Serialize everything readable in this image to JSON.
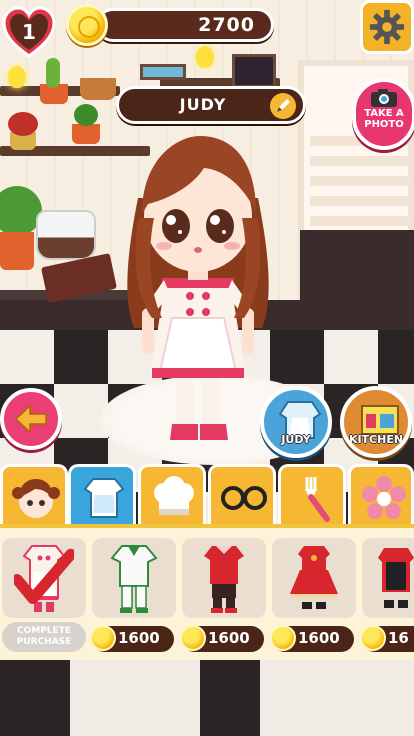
{
  "hud": {
    "level": "1",
    "coins": "2700",
    "character_name": "JUDY",
    "photo_label_line1": "TAKE A",
    "photo_label_line2": "PHOTO"
  },
  "buttons": {
    "judy_label": "JUDY",
    "kitchen_label": "KITCHEN"
  },
  "tabs": [
    {
      "icon": "hair-icon",
      "color": "#f6b732"
    },
    {
      "icon": "outfit-icon",
      "color": "#39a6dc"
    },
    {
      "icon": "chef-hat-icon",
      "color": "#f6b732"
    },
    {
      "icon": "glasses-icon",
      "color": "#f6b732"
    },
    {
      "icon": "fork-icon",
      "color": "#f6b732"
    },
    {
      "icon": "flower-icon",
      "color": "#f6b732"
    }
  ],
  "items": [
    {
      "name": "pink-white-dress",
      "status": "COMPLETE PURCHASE",
      "owned": true
    },
    {
      "name": "white-green-outfit",
      "price": "1600"
    },
    {
      "name": "red-black-outfit",
      "price": "1600"
    },
    {
      "name": "red-frill-dress",
      "price": "1600"
    },
    {
      "name": "red-apron-outfit",
      "price": "16"
    }
  ],
  "colors": {
    "accent_pink": "#e8366f",
    "coin_gold": "#f5b400",
    "bar_brown": "#4a2518",
    "tab_yellow": "#f6b732",
    "tab_blue": "#39a6dc"
  }
}
